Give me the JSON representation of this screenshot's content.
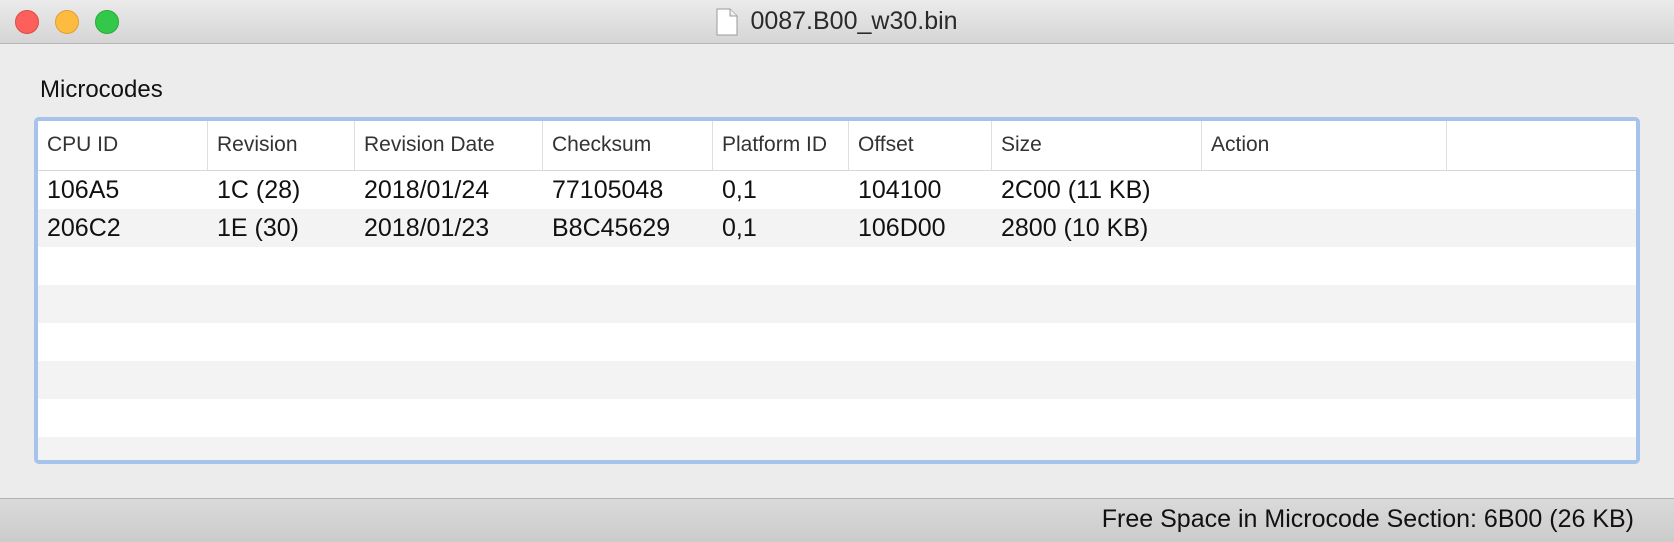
{
  "window": {
    "title": "0087.B00_w30.bin"
  },
  "section": {
    "label": "Microcodes"
  },
  "table": {
    "columns": [
      "CPU ID",
      "Revision",
      "Revision Date",
      "Checksum",
      "Platform ID",
      "Offset",
      "Size",
      "Action",
      ""
    ],
    "rows": [
      {
        "cpu_id": "106A5",
        "revision": "1C (28)",
        "revision_date": "2018/01/24",
        "checksum": "77105048",
        "platform_id": "0,1",
        "offset": "104100",
        "size": "2C00 (11 KB)",
        "action": ""
      },
      {
        "cpu_id": "206C2",
        "revision": "1E (30)",
        "revision_date": "2018/01/23",
        "checksum": "B8C45629",
        "platform_id": "0,1",
        "offset": "106D00",
        "size": "2800 (10 KB)",
        "action": ""
      }
    ]
  },
  "status": {
    "text": "Free Space in Microcode Section: 6B00 (26 KB)"
  },
  "colors": {
    "focus_ring": "#a6c3ec",
    "close": "#fc605c",
    "minimize": "#fdbc40",
    "maximize": "#34c84a"
  },
  "icons": {
    "title": "document-icon"
  }
}
